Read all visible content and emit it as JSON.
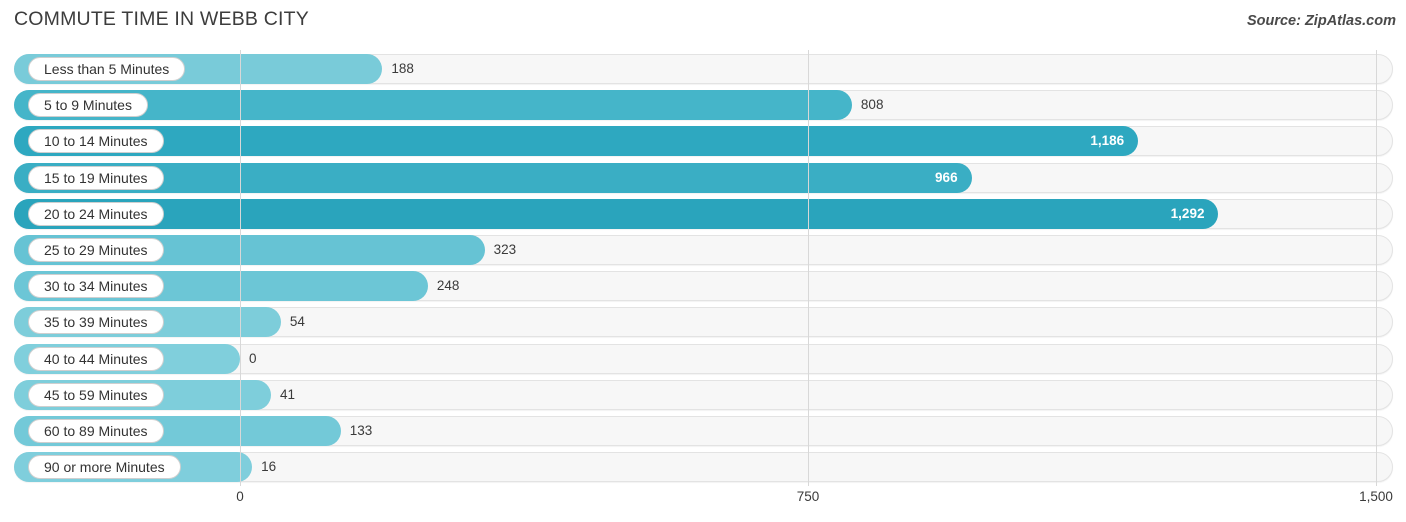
{
  "header": {
    "title": "COMMUTE TIME IN WEBB CITY",
    "source": "Source: ZipAtlas.com"
  },
  "chart_data": {
    "type": "bar",
    "orientation": "horizontal",
    "title": "COMMUTE TIME IN WEBB CITY",
    "xlabel": "",
    "ylabel": "",
    "xlim": [
      0,
      1500
    ],
    "grid": true,
    "legend": false,
    "xticks": [
      0,
      750,
      1500
    ],
    "xticklabels": [
      "0",
      "750",
      "1,500"
    ],
    "categories": [
      "Less than 5 Minutes",
      "5 to 9 Minutes",
      "10 to 14 Minutes",
      "15 to 19 Minutes",
      "20 to 24 Minutes",
      "25 to 29 Minutes",
      "30 to 34 Minutes",
      "35 to 39 Minutes",
      "40 to 44 Minutes",
      "45 to 59 Minutes",
      "60 to 89 Minutes",
      "90 or more Minutes"
    ],
    "values": [
      188,
      808,
      1186,
      966,
      1292,
      323,
      248,
      54,
      0,
      41,
      133,
      16
    ],
    "value_labels": [
      "188",
      "808",
      "1,186",
      "966",
      "1,292",
      "323",
      "248",
      "54",
      "0",
      "41",
      "133",
      "16"
    ],
    "bar_colors": [
      "#79cbd9",
      "#45b5c9",
      "#2ea8c0",
      "#3aaec4",
      "#2aa4bc",
      "#66c3d4",
      "#6cc6d6",
      "#7dcdda",
      "#80cfdc",
      "#7ecedb",
      "#73c9d8",
      "#7fcedc"
    ],
    "label_inside": [
      false,
      false,
      true,
      true,
      true,
      false,
      false,
      false,
      false,
      false,
      false,
      false
    ]
  },
  "colors": {
    "accent_dark": "#2aa4bc",
    "accent_light": "#80cfdc",
    "track": "#f7f7f7",
    "gridline": "#d8d8d8"
  }
}
